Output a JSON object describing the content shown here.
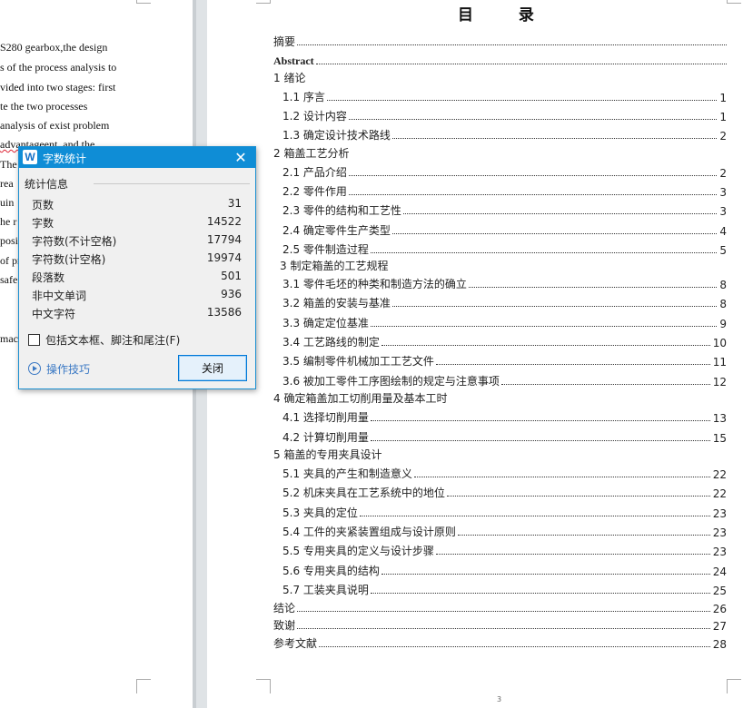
{
  "left_page": {
    "lines": [
      "S280 gearbox,the design",
      "s of the process analysis to",
      "vided into two stages: first",
      "te the two processes",
      "analysis of    exist problem",
      "advantageent, and the",
      "The",
      "rea",
      "uin",
      "he r",
      "posi",
      "of pr",
      "safe",
      "mac"
    ]
  },
  "document": {
    "title": "目        录",
    "page_number": "3",
    "toc": [
      {
        "label": "摘要",
        "page": ""
      },
      {
        "label": "Abstract",
        "page": ""
      },
      {
        "label": "1  绪论",
        "page": ""
      },
      {
        "label": "1.1 序言",
        "page": "1"
      },
      {
        "label": "1.2 设计内容",
        "page": "1"
      },
      {
        "label": "1.3 确定设计技术路线",
        "page": "2"
      },
      {
        "label": "2  箱盖工艺分析",
        "page": ""
      },
      {
        "label": "2.1 产品介绍",
        "page": "2"
      },
      {
        "label": "2.2 零件作用",
        "page": "3"
      },
      {
        "label": "2.3 零件的结构和工艺性",
        "page": "3"
      },
      {
        "label": "2.4 确定零件生产类型",
        "page": "4"
      },
      {
        "label": "2.5 零件制造过程",
        "page": "5"
      },
      {
        "label": "3 制定箱盖的工艺规程",
        "page": ""
      },
      {
        "label": "3.1 零件毛坯的种类和制造方法的确立",
        "page": "8"
      },
      {
        "label": "3.2 箱盖的安装与基准",
        "page": "8"
      },
      {
        "label": "3.3 确定定位基准",
        "page": "9"
      },
      {
        "label": "3.4 工艺路线的制定",
        "page": "10"
      },
      {
        "label": "3.5 编制零件机械加工工艺文件",
        "page": "11"
      },
      {
        "label": "3.6 被加工零件工序图绘制的规定与注意事项",
        "page": "12"
      },
      {
        "label": "4  确定箱盖加工切削用量及基本工时",
        "page": ""
      },
      {
        "label": "4.1 选择切削用量",
        "page": "13"
      },
      {
        "label": "4.2 计算切削用量",
        "page": "15"
      },
      {
        "label": "5  箱盖的专用夹具设计",
        "page": ""
      },
      {
        "label": "5.1 夹具的产生和制造意义",
        "page": "22"
      },
      {
        "label": "5.2 机床夹具在工艺系统中的地位",
        "page": "22"
      },
      {
        "label": "5.3 夹具的定位",
        "page": "23"
      },
      {
        "label": "5.4 工件的夹紧装置组成与设计原则",
        "page": "23"
      },
      {
        "label": "5.5 专用夹具的定义与设计步骤",
        "page": "23"
      },
      {
        "label": "5.6 专用夹具的结构",
        "page": "24"
      },
      {
        "label": "5.7 工装夹具说明",
        "page": "25"
      },
      {
        "label": "结论",
        "page": "26"
      },
      {
        "label": "致谢",
        "page": "27"
      },
      {
        "label": "参考文献",
        "page": "28"
      }
    ]
  },
  "dialog": {
    "app_icon": "W",
    "title": "字数统计",
    "close_glyph": "✕",
    "group_title": "统计信息",
    "stats": [
      {
        "label": "页数",
        "value": "31"
      },
      {
        "label": "字数",
        "value": "14522"
      },
      {
        "label": "字符数(不计空格)",
        "value": "17794"
      },
      {
        "label": "字符数(计空格)",
        "value": "19974"
      },
      {
        "label": "段落数",
        "value": "501"
      },
      {
        "label": "非中文单词",
        "value": "936"
      },
      {
        "label": "中文字符",
        "value": "13586"
      }
    ],
    "checkbox_label": "包括文本框、脚注和尾注(F)",
    "checkbox_checked": false,
    "tips_label": "操作技巧",
    "close_button": "关闭"
  }
}
